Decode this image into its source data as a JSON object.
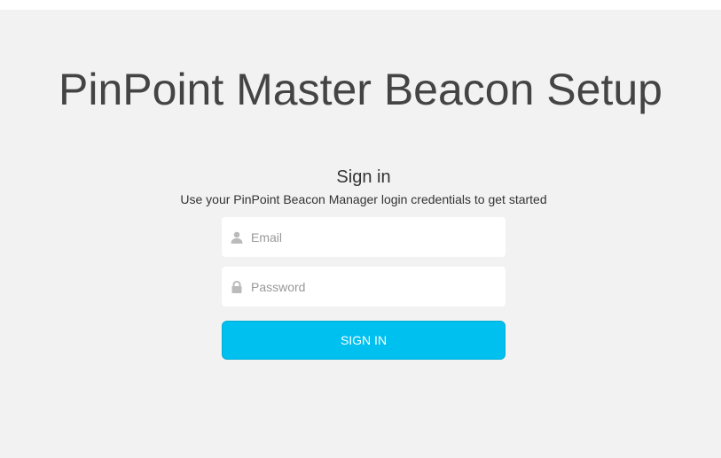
{
  "header": {
    "title": "PinPoint Master Beacon Setup"
  },
  "signin": {
    "heading": "Sign in",
    "subtitle": "Use your PinPoint Beacon Manager login credentials to get started",
    "email": {
      "placeholder": "Email",
      "value": "",
      "icon": "user-icon"
    },
    "password": {
      "placeholder": "Password",
      "value": "",
      "icon": "lock-icon"
    },
    "button_label": "SIGN IN"
  },
  "colors": {
    "background": "#f2f2f2",
    "accent": "#00c0ef",
    "title_text": "#444444",
    "icon": "#bbbbbb"
  }
}
